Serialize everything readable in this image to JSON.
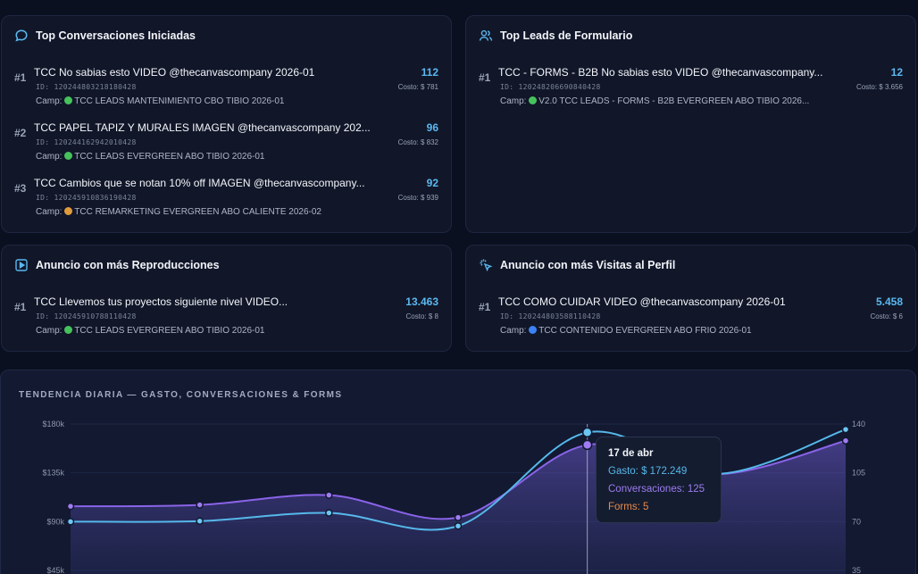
{
  "colors": {
    "gasto": "#56b8ea",
    "conversaciones": "#8a63e8",
    "forms": "#e98a4a",
    "metric": "#5ab8f0",
    "green_dot": "#46c25c",
    "orange_dot": "#e09a3c",
    "blue_dot": "#3b82f6"
  },
  "cards": {
    "conversaciones": {
      "title": "Top Conversaciones Iniciadas",
      "icon": "chat-bubble-icon",
      "items": [
        {
          "rank": "#1",
          "title": "TCC No sabias esto VIDEO @thecanvascompany 2026-01",
          "id": "ID: 120244803218180428",
          "campaign": "TCC LEADS MANTENIMIENTO CBO TIBIO 2026-01",
          "dot": "green",
          "metric": "112",
          "cost": "Costo: $ 781"
        },
        {
          "rank": "#2",
          "title": "TCC PAPEL TAPIZ Y MURALES IMAGEN @thecanvascompany 202...",
          "id": "ID: 120244162942010428",
          "campaign": "TCC LEADS EVERGREEN ABO TIBIO 2026-01",
          "dot": "green",
          "metric": "96",
          "cost": "Costo: $ 832"
        },
        {
          "rank": "#3",
          "title": "TCC Cambios que se notan 10% off IMAGEN @thecanvascompany...",
          "id": "ID: 120245910836190428",
          "campaign": "TCC REMARKETING EVERGREEN ABO CALIENTE 2026-02",
          "dot": "orange",
          "metric": "92",
          "cost": "Costo: $ 939"
        }
      ]
    },
    "leads": {
      "title": "Top Leads de Formulario",
      "icon": "users-icon",
      "items": [
        {
          "rank": "#1",
          "title": "TCC - FORMS - B2B No sabias esto VIDEO @thecanvascompany...",
          "id": "ID: 120248206690840428",
          "campaign": "V2.0 TCC LEADS - FORMS - B2B EVERGREEN ABO TIBIO 2026...",
          "dot": "green",
          "metric": "12",
          "cost": "Costo: $ 3.656"
        }
      ]
    },
    "reproducciones": {
      "title": "Anuncio con más Reproducciones",
      "icon": "play-square-icon",
      "items": [
        {
          "rank": "#1",
          "title": "TCC Llevemos tus proyectos siguiente nivel VIDEO...",
          "id": "ID: 120245910788110428",
          "campaign": "TCC LEADS EVERGREEN ABO TIBIO 2026-01",
          "dot": "green",
          "metric": "13.463",
          "cost": "Costo: $ 8"
        }
      ]
    },
    "visitas": {
      "title": "Anuncio con más Visitas al Perfil",
      "icon": "cursor-click-icon",
      "items": [
        {
          "rank": "#1",
          "title": "TCC COMO CUIDAR VIDEO @thecanvascompany 2026-01",
          "id": "ID: 120244803588110428",
          "campaign": "TCC CONTENIDO EVERGREEN ABO FRIO 2026-01",
          "dot": "blue",
          "metric": "5.458",
          "cost": "Costo: $ 6"
        }
      ]
    }
  },
  "chart_data": {
    "type": "area",
    "title": "TENDENCIA DIARIA — GASTO, CONVERSACIONES & FORMS",
    "left_ticks": [
      "$180k",
      "$135k",
      "$90k",
      "$45k"
    ],
    "right_ticks": [
      "140",
      "105",
      "70",
      "35"
    ],
    "ylim_left": [
      45000,
      180000
    ],
    "ylim_right": [
      35,
      140
    ],
    "series": [
      {
        "name": "Gasto",
        "axis": "left",
        "values": [
          90000,
          90500,
          98000,
          86000,
          172249,
          134000,
          175000
        ]
      },
      {
        "name": "Conversaciones",
        "axis": "right",
        "values": [
          81,
          82,
          89,
          73,
          125,
          104,
          128
        ]
      }
    ],
    "highlight_index": 4,
    "tooltip": {
      "date": "17 de abr",
      "gasto": "Gasto: $ 172.249",
      "conversaciones": "Conversaciones: 125",
      "forms": "Forms: 5"
    }
  }
}
